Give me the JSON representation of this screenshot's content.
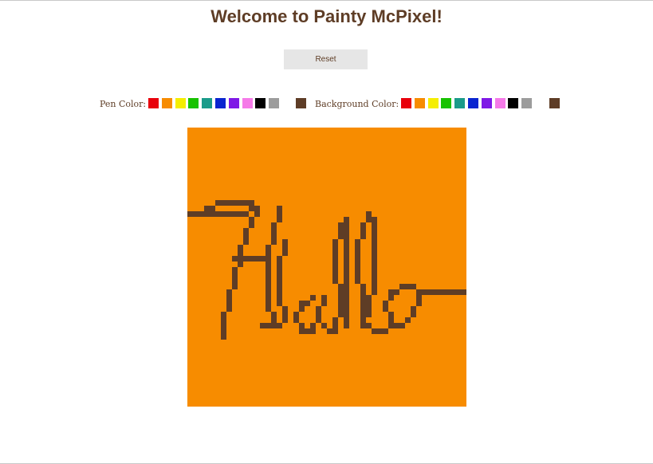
{
  "app": {
    "title": "Welcome to Painty McPixel!",
    "reset_label": "Reset"
  },
  "pen_palette": {
    "label": "Pen Color:",
    "colors": [
      "#e8000b",
      "#f78c00",
      "#f5ee00",
      "#18c200",
      "#1a9b8a",
      "#0a25d0",
      "#7f18e6",
      "#f57ae8",
      "#000000",
      "#9c9c9c"
    ],
    "selected": "#5e3d26"
  },
  "background_palette": {
    "label": "Background Color:",
    "colors": [
      "#e8000b",
      "#f78c00",
      "#f5ee00",
      "#18c200",
      "#1a9b8a",
      "#0a25d0",
      "#7f18e6",
      "#f57ae8",
      "#000000",
      "#9c9c9c"
    ],
    "selected": "#5e3d26"
  },
  "canvas": {
    "grid_size": 50,
    "background_color": "#f78c00",
    "pen_color": "#5e3d26",
    "drawing_text": "Hello",
    "strokes": [
      [
        [
          0,
          15
        ],
        [
          4,
          15
        ],
        [
          8,
          15
        ],
        [
          12,
          14
        ],
        [
          11,
          16
        ],
        [
          10,
          19
        ],
        [
          9,
          22
        ],
        [
          8,
          26
        ],
        [
          7,
          30
        ],
        [
          6,
          35
        ],
        [
          6,
          37
        ]
      ],
      [
        [
          3,
          14
        ],
        [
          5,
          13
        ],
        [
          8,
          13
        ],
        [
          11,
          13
        ]
      ],
      [
        [
          8,
          23
        ],
        [
          11,
          23
        ],
        [
          14,
          23
        ]
      ],
      [
        [
          16,
          14
        ],
        [
          15,
          18
        ],
        [
          14,
          22
        ],
        [
          14,
          26
        ],
        [
          14,
          31
        ],
        [
          15,
          34
        ]
      ],
      [
        [
          17,
          20
        ],
        [
          16,
          25
        ],
        [
          16,
          30
        ],
        [
          17,
          34
        ]
      ],
      [
        [
          13,
          35
        ],
        [
          15,
          35
        ],
        [
          17,
          34
        ]
      ],
      [
        [
          22,
          30
        ],
        [
          20,
          31
        ],
        [
          19,
          34
        ],
        [
          20,
          36
        ],
        [
          22,
          36
        ],
        [
          23,
          33
        ],
        [
          24,
          30
        ]
      ],
      [
        [
          24,
          35
        ],
        [
          26,
          36
        ]
      ],
      [
        [
          26,
          36
        ],
        [
          27,
          30
        ],
        [
          26,
          26
        ],
        [
          26,
          22
        ],
        [
          27,
          17
        ],
        [
          28,
          16
        ],
        [
          28,
          20
        ],
        [
          28,
          25
        ],
        [
          28,
          30
        ],
        [
          28,
          35
        ]
      ],
      [
        [
          31,
          35
        ],
        [
          31,
          30
        ],
        [
          30,
          26
        ],
        [
          30,
          21
        ],
        [
          31,
          17
        ],
        [
          32,
          15
        ],
        [
          33,
          17
        ],
        [
          33,
          22
        ],
        [
          33,
          27
        ],
        [
          32,
          31
        ],
        [
          31,
          35
        ]
      ],
      [
        [
          32,
          35
        ],
        [
          34,
          36
        ],
        [
          36,
          35
        ]
      ],
      [
        [
          36,
          34
        ],
        [
          35,
          31
        ],
        [
          36,
          29
        ],
        [
          38,
          28
        ],
        [
          40,
          28
        ],
        [
          41,
          30
        ],
        [
          40,
          33
        ],
        [
          38,
          35
        ],
        [
          36,
          35
        ]
      ],
      [
        [
          41,
          29
        ],
        [
          44,
          29
        ],
        [
          47,
          29
        ],
        [
          50,
          29
        ]
      ]
    ]
  }
}
